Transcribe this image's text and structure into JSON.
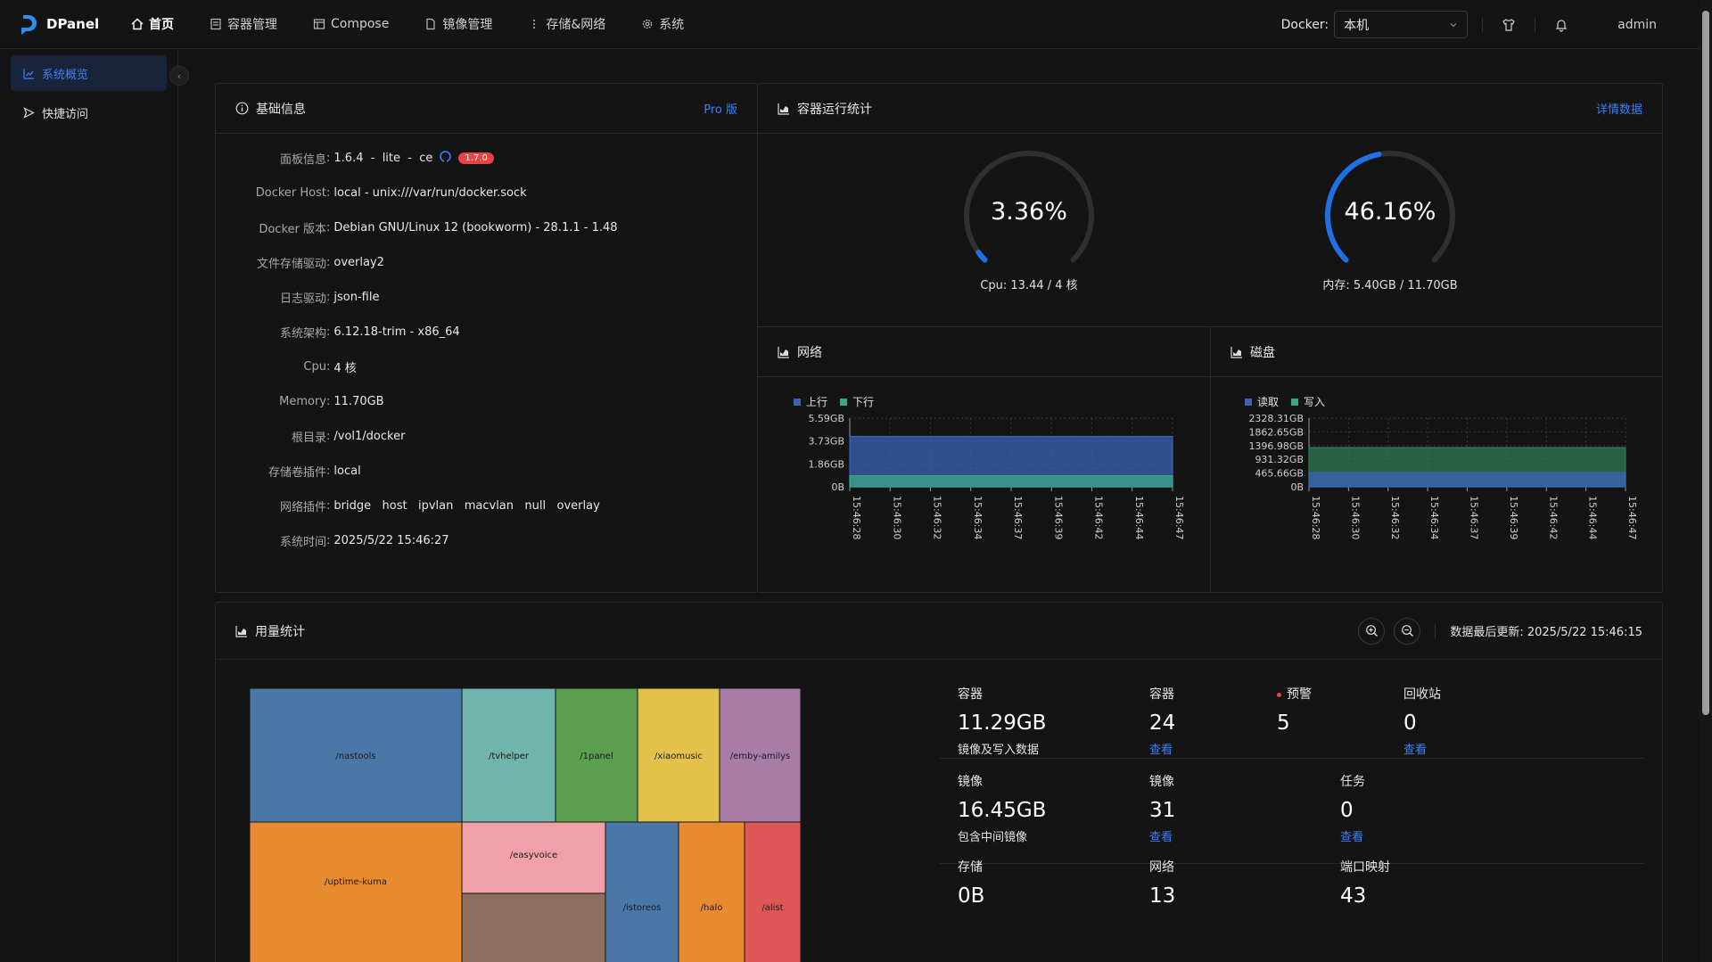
{
  "app": {
    "name": "DPanel"
  },
  "nav": [
    {
      "label": "首页",
      "icon": "home-icon",
      "active": true
    },
    {
      "label": "容器管理",
      "icon": "container-icon"
    },
    {
      "label": "Compose",
      "icon": "compose-icon"
    },
    {
      "label": "镜像管理",
      "icon": "file-icon"
    },
    {
      "label": "存储&网络",
      "icon": "dots-icon"
    },
    {
      "label": "系统",
      "icon": "gear-icon"
    }
  ],
  "header": {
    "docker_label": "Docker:",
    "docker_value": "本机",
    "user": "admin"
  },
  "sidebar": [
    {
      "label": "系统概览",
      "icon": "chart-icon",
      "active": true
    },
    {
      "label": "快捷访问",
      "icon": "send-icon"
    }
  ],
  "basic_info": {
    "title": "基础信息",
    "pro_link": "Pro 版",
    "rows": [
      {
        "key": "面板信息",
        "value": "1.6.4  -  lite  -  ce",
        "github": true,
        "badge": "1.7.0"
      },
      {
        "key": "Docker Host",
        "value": "local - unix:///var/run/docker.sock"
      },
      {
        "key": "Docker 版本",
        "value": "Debian GNU/Linux 12 (bookworm) - 28.1.1 - 1.48"
      },
      {
        "key": "文件存储驱动",
        "value": "overlay2"
      },
      {
        "key": "日志驱动",
        "value": "json-file"
      },
      {
        "key": "系统架构",
        "value": "6.12.18-trim - x86_64"
      },
      {
        "key": "Cpu",
        "value": "4 核"
      },
      {
        "key": "Memory",
        "value": "11.70GB"
      },
      {
        "key": "根目录",
        "value": "/vol1/docker"
      },
      {
        "key": "存储卷插件",
        "value": "local"
      },
      {
        "key": "网络插件",
        "value": "bridge   host   ipvlan   macvlan   null   overlay"
      },
      {
        "key": "系统时间",
        "value": "2025/5/22 15:46:27"
      }
    ]
  },
  "runtime": {
    "title": "容器运行统计",
    "detail_link": "详情数据",
    "cpu": {
      "percent_text": "3.36%",
      "percent": 3.36,
      "caption": "Cpu: 13.44 / 4 核"
    },
    "mem": {
      "percent_text": "46.16%",
      "percent": 46.16,
      "caption": "内存: 5.40GB / 11.70GB"
    }
  },
  "network": {
    "title": "网络"
  },
  "disk": {
    "title": "磁盘"
  },
  "chart_data": [
    {
      "type": "area",
      "title": "网络",
      "x": [
        "15:46:28",
        "15:46:30",
        "15:46:32",
        "15:46:34",
        "15:46:37",
        "15:46:39",
        "15:46:42",
        "15:46:44",
        "15:46:47"
      ],
      "y_ticks": [
        "5.59GB",
        "3.73GB",
        "1.86GB",
        "0B"
      ],
      "ylim": [
        0,
        5.59
      ],
      "series": [
        {
          "name": "上行",
          "color": "#3b63b5",
          "values": [
            4.1,
            4.1,
            4.1,
            4.1,
            4.1,
            4.1,
            4.1,
            4.1,
            4.1
          ]
        },
        {
          "name": "下行",
          "color": "#3aa58c",
          "values": [
            0.9,
            0.9,
            0.9,
            0.9,
            0.9,
            0.9,
            0.9,
            0.9,
            0.9
          ]
        }
      ],
      "legend": "top-left",
      "grid": true
    },
    {
      "type": "area",
      "title": "磁盘",
      "x": [
        "15:46:28",
        "15:46:30",
        "15:46:32",
        "15:46:34",
        "15:46:37",
        "15:46:39",
        "15:46:42",
        "15:46:44",
        "15:46:47"
      ],
      "y_ticks": [
        "2328.31GB",
        "1862.65GB",
        "1396.98GB",
        "931.32GB",
        "465.66GB",
        "0B"
      ],
      "ylim": [
        0,
        2328.31
      ],
      "series": [
        {
          "name": "读取",
          "color": "#3b63b5",
          "values": [
            480,
            480,
            480,
            480,
            480,
            480,
            480,
            480,
            480
          ]
        },
        {
          "name": "写入",
          "color": "#2f7a55",
          "values": [
            1330,
            1330,
            1330,
            1330,
            1330,
            1330,
            1330,
            1330,
            1330
          ]
        }
      ],
      "legend": "top-left",
      "grid": true
    }
  ],
  "usage": {
    "title": "用量统计",
    "updated": "数据最后更新: 2025/5/22 15:46:15",
    "treemap": [
      {
        "label": "/nastools",
        "color": "#4a77a8"
      },
      {
        "label": "/tvhelper",
        "color": "#71b4ac"
      },
      {
        "label": "/1panel",
        "color": "#5a9e4e"
      },
      {
        "label": "/xiaomusic",
        "color": "#e3c14a"
      },
      {
        "label": "/emby-amilys",
        "color": "#a77ca6"
      },
      {
        "label": "/uptime-kuma",
        "color": "#e88b30"
      },
      {
        "label": "/easyvoice",
        "color": "#f1a0a8"
      },
      {
        "label": "",
        "color": "#8e6e5e"
      },
      {
        "label": "/istoreos",
        "color": "#4a77a8"
      },
      {
        "label": "/halo",
        "color": "#e88b30"
      },
      {
        "label": "/alist",
        "color": "#dd5757"
      }
    ],
    "stats": [
      {
        "title": "容器",
        "value": "11.29GB",
        "sub": "镜像及写入数据"
      },
      {
        "title": "容器",
        "value": "24",
        "link": "查看"
      },
      {
        "title": "预警",
        "value": "5",
        "dot": true
      },
      {
        "title": "回收站",
        "value": "0",
        "link": "查看"
      },
      {
        "title": "镜像",
        "value": "16.45GB",
        "sub": "包含中间镜像"
      },
      {
        "title": "镜像",
        "value": "31",
        "link": "查看"
      },
      {
        "title": "任务",
        "value": "0",
        "link": "查看"
      },
      {
        "title": "存储",
        "value": "0B"
      },
      {
        "title": "网络",
        "value": "13"
      },
      {
        "title": "端口映射",
        "value": "43"
      }
    ]
  }
}
